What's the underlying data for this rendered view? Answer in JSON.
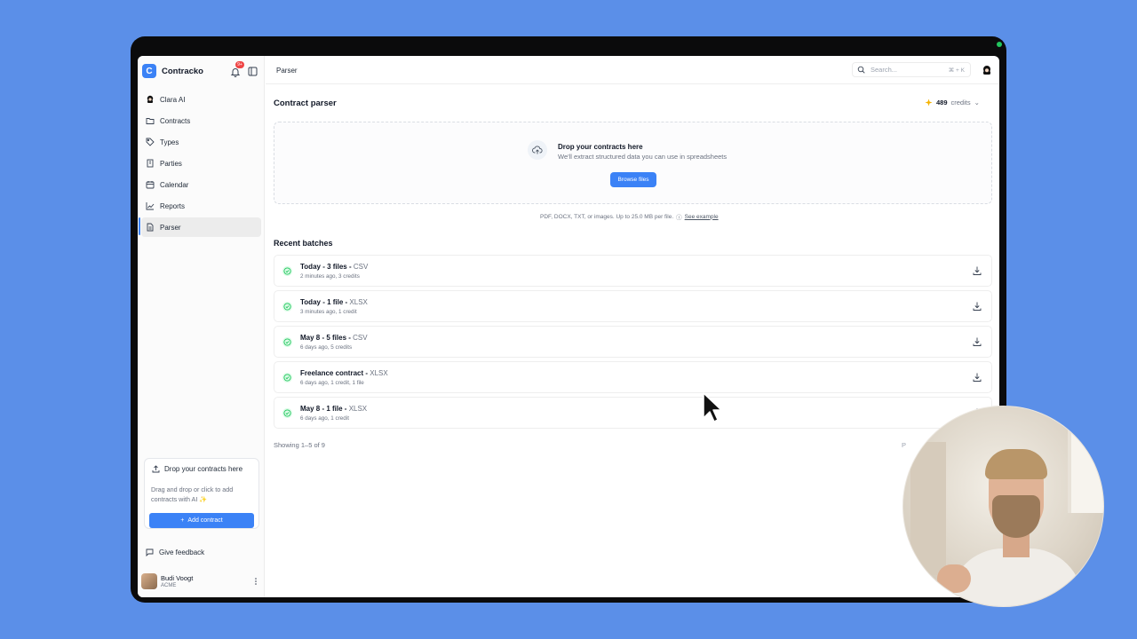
{
  "app": {
    "name": "Contracko",
    "notification_count": "9+"
  },
  "sidebar": {
    "items": [
      {
        "label": "Clara AI",
        "icon": "clara-ai-icon"
      },
      {
        "label": "Contracts",
        "icon": "folder-icon"
      },
      {
        "label": "Types",
        "icon": "tag-icon"
      },
      {
        "label": "Parties",
        "icon": "building-icon"
      },
      {
        "label": "Calendar",
        "icon": "calendar-icon"
      },
      {
        "label": "Reports",
        "icon": "chart-line-icon"
      },
      {
        "label": "Parser",
        "icon": "document-icon",
        "active": true
      }
    ],
    "drop_card": {
      "title": "Drop your contracts here",
      "text": "Drag and drop or click to add contracts with AI ✨",
      "button": "Add contract"
    },
    "feedback_label": "Give feedback",
    "user": {
      "name": "Budi Voogt",
      "org": "ACME"
    }
  },
  "topbar": {
    "breadcrumb": "Parser",
    "search_placeholder": "Search...",
    "shortcut": "⌘ + K"
  },
  "main": {
    "title": "Contract parser",
    "credits_value": "489",
    "credits_label": "credits",
    "dropzone": {
      "title": "Drop your contracts here",
      "subtitle": "We'll extract structured data you can use in spreadsheets",
      "button": "Browse files",
      "hint": "PDF, DOCX, TXT, or images. Up to 25.0 MB per file.",
      "hint_link": "See example"
    },
    "recent_title": "Recent batches",
    "batches": [
      {
        "title": "Today - 3 files",
        "format": "CSV",
        "meta": "2 minutes ago, 3 credits"
      },
      {
        "title": "Today - 1 file",
        "format": "XLSX",
        "meta": "3 minutes ago, 1 credit"
      },
      {
        "title": "May 8 - 5 files",
        "format": "CSV",
        "meta": "6 days ago, 5 credits"
      },
      {
        "title": "Freelance contract",
        "format": "XLSX",
        "meta": "6 days ago, 1 credit, 1 file"
      },
      {
        "title": "May 8 - 1 file",
        "format": "XLSX",
        "meta": "6 days ago, 1 credit"
      }
    ],
    "showing": "Showing 1–5 of 9",
    "pager_peek": "P"
  },
  "colors": {
    "accent": "#3b82f6",
    "success": "#22c55e",
    "background": "#5b8fe8"
  }
}
